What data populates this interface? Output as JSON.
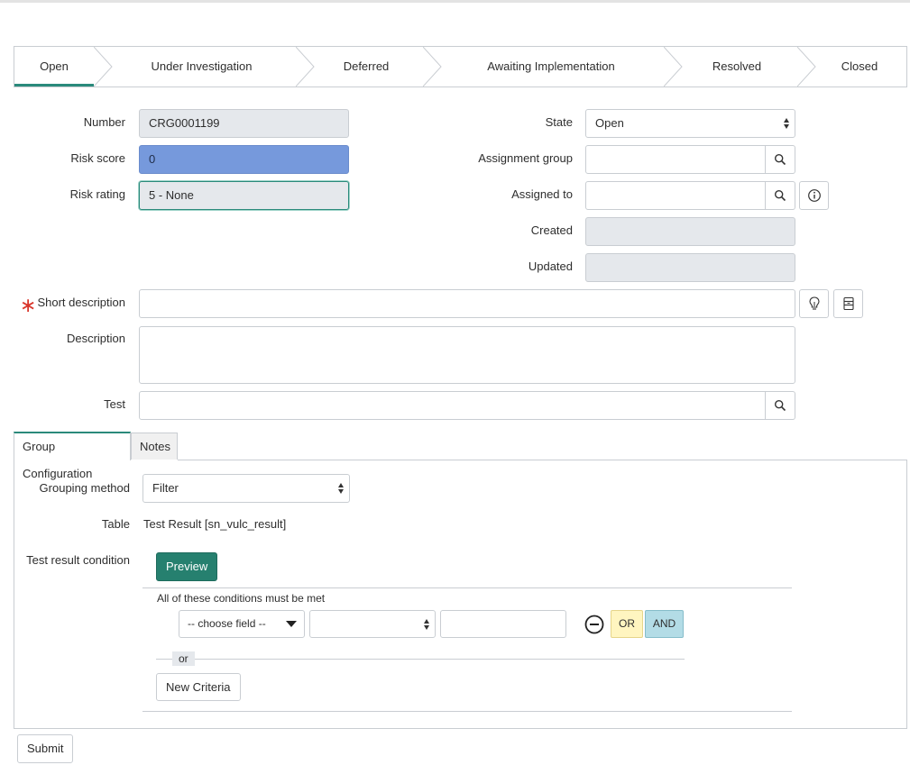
{
  "stages": [
    {
      "label": "Open",
      "active": true
    },
    {
      "label": "Under Investigation",
      "active": false
    },
    {
      "label": "Deferred",
      "active": false
    },
    {
      "label": "Awaiting Implementation",
      "active": false
    },
    {
      "label": "Resolved",
      "active": false
    },
    {
      "label": "Closed",
      "active": false
    }
  ],
  "form": {
    "number_label": "Number",
    "number_value": "CRG0001199",
    "risk_score_label": "Risk score",
    "risk_score_value": "0",
    "risk_rating_label": "Risk rating",
    "risk_rating_value": "5 - None",
    "state_label": "State",
    "state_value": "Open",
    "assignment_group_label": "Assignment group",
    "assignment_group_value": "",
    "assigned_to_label": "Assigned to",
    "assigned_to_value": "",
    "created_label": "Created",
    "created_value": "",
    "updated_label": "Updated",
    "updated_value": "",
    "required_marker": "∗",
    "short_description_label": "Short description",
    "short_description_value": "",
    "description_label": "Description",
    "description_value": "",
    "test_label": "Test",
    "test_value": ""
  },
  "tabs": [
    {
      "label": "Group Configuration",
      "active": true
    },
    {
      "label": "Notes",
      "active": false
    }
  ],
  "group_config": {
    "grouping_method_label": "Grouping method",
    "grouping_method_value": "Filter",
    "table_label": "Table",
    "table_value": "Test Result [sn_vulc_result]",
    "condition_label": "Test result condition",
    "preview_label": "Preview",
    "conditions_heading": "All of these conditions must be met",
    "choose_field": "-- choose field --",
    "operator_value": "",
    "condition_value": "",
    "or_button": "OR",
    "and_button": "AND",
    "or_separator": "or",
    "new_criteria_label": "New Criteria"
  },
  "submit_label": "Submit",
  "colors": {
    "accent": "#2a8a7b",
    "primary_button": "#26806f",
    "risk_score_fill": "#7699dc",
    "required": "#d9362b",
    "or_fill": "#fff5c0",
    "and_fill": "#b3dce6"
  },
  "icons": [
    "search-icon",
    "info-icon",
    "lightbulb-icon",
    "archive-icon",
    "remove-condition-icon",
    "dropdown-caret-icon"
  ]
}
